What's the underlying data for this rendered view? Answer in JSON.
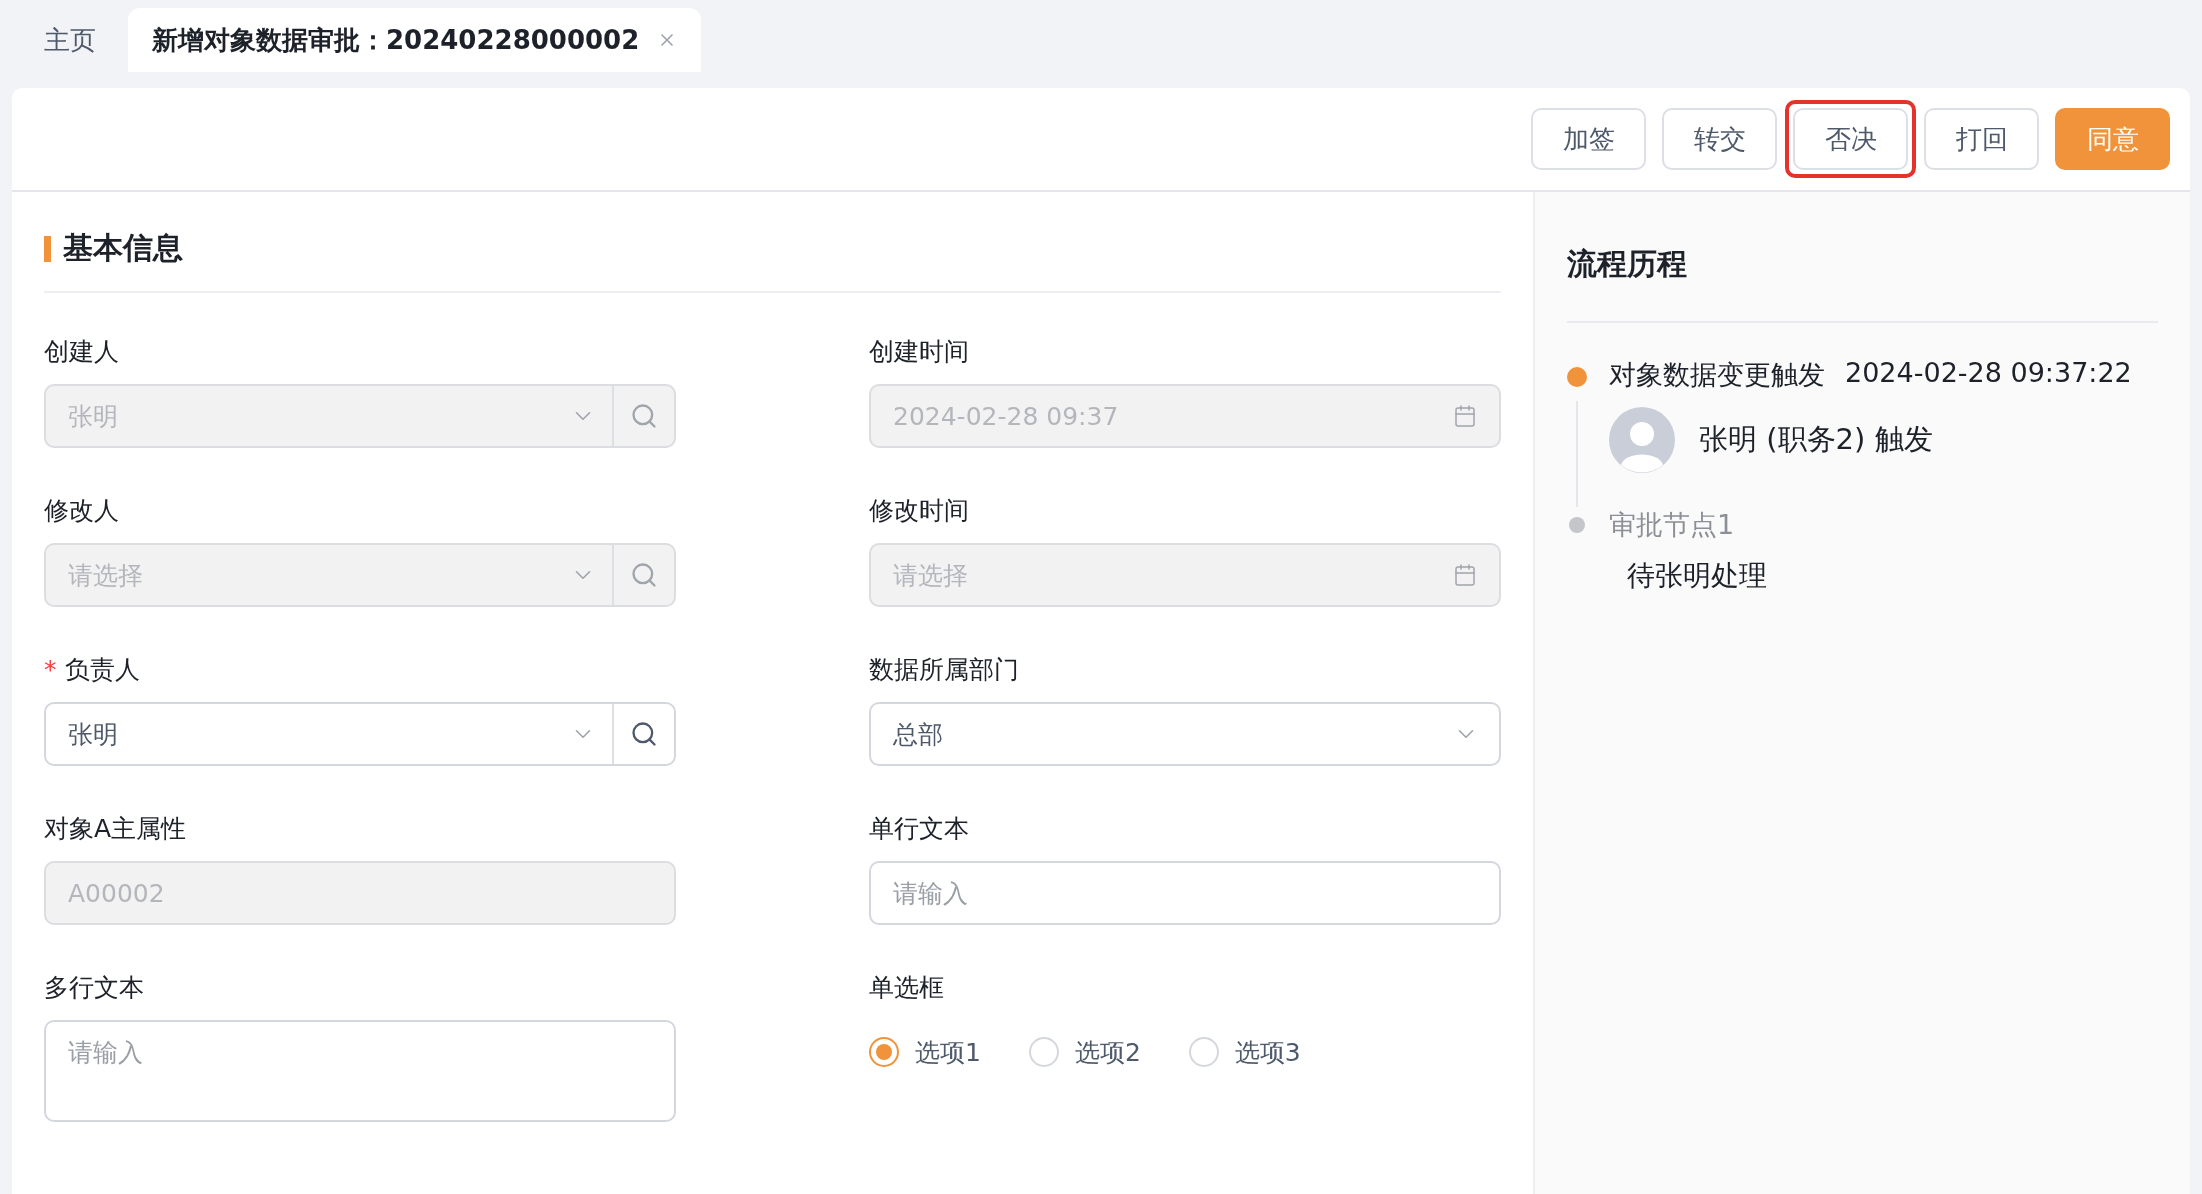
{
  "tabs": [
    {
      "label": "主页",
      "selected": false,
      "closable": false
    },
    {
      "label": "新增对象数据审批：20240228000002",
      "selected": true,
      "closable": true
    }
  ],
  "actions": [
    {
      "label": "加签",
      "kind": "default",
      "highlighted": false
    },
    {
      "label": "转交",
      "kind": "default",
      "highlighted": false
    },
    {
      "label": "否决",
      "kind": "default",
      "highlighted": true
    },
    {
      "label": "打回",
      "kind": "default",
      "highlighted": false
    },
    {
      "label": "同意",
      "kind": "primary",
      "highlighted": false
    }
  ],
  "section": {
    "title": "基本信息"
  },
  "fields": [
    {
      "kind": "lookup",
      "label": "创建人",
      "disabled": true,
      "value": "张明"
    },
    {
      "kind": "date",
      "label": "创建时间",
      "disabled": true,
      "value": "2024-02-28 09:37"
    },
    {
      "kind": "lookup",
      "label": "修改人",
      "disabled": true,
      "placeholder": "请选择"
    },
    {
      "kind": "date",
      "label": "修改时间",
      "disabled": true,
      "placeholder": "请选择"
    },
    {
      "kind": "lookup",
      "label": "负责人",
      "required_mark": "*",
      "disabled": false,
      "value": "张明"
    },
    {
      "kind": "select",
      "label": "数据所属部门",
      "disabled": false,
      "value": "总部"
    },
    {
      "kind": "text",
      "label": "对象A主属性",
      "disabled": true,
      "value": "A00002"
    },
    {
      "kind": "text",
      "label": "单行文本",
      "disabled": false,
      "placeholder": "请输入"
    },
    {
      "kind": "textarea",
      "label": "多行文本",
      "disabled": false,
      "placeholder": "请输入"
    },
    {
      "kind": "radio",
      "label": "单选框",
      "options": [
        {
          "label": "选项1",
          "selected": true
        },
        {
          "label": "选项2",
          "selected": false
        },
        {
          "label": "选项3",
          "selected": false
        }
      ]
    }
  ],
  "history": {
    "title": "流程历程",
    "steps": [
      {
        "active": true,
        "title": "对象数据变更触发",
        "time": "2024-02-28 09:37:22",
        "actor": "张明 (职务2) 触发"
      },
      {
        "active": false,
        "title": "审批节点1",
        "note": "待张明处理"
      }
    ]
  }
}
